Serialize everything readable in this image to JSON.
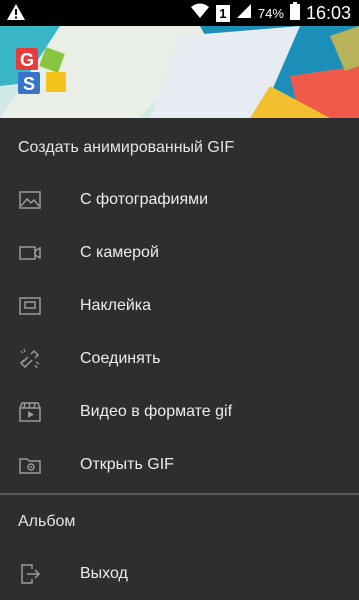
{
  "status_bar": {
    "battery_percent": "74%",
    "time": "16:03",
    "sim": "1"
  },
  "drawer": {
    "section_create_title": "Создать анимированный GIF",
    "items": [
      {
        "label": "С фотографиями",
        "icon": "image-icon"
      },
      {
        "label": "С камерой",
        "icon": "video-camera-icon"
      },
      {
        "label": "Наклейка",
        "icon": "sticker-icon"
      },
      {
        "label": "Соединять",
        "icon": "link-icon"
      },
      {
        "label": "Видео в формате gif",
        "icon": "video-clip-icon"
      },
      {
        "label": "Открыть GIF",
        "icon": "folder-gear-icon"
      }
    ],
    "section_album_title": "Альбом",
    "exit_label": "Выход"
  }
}
